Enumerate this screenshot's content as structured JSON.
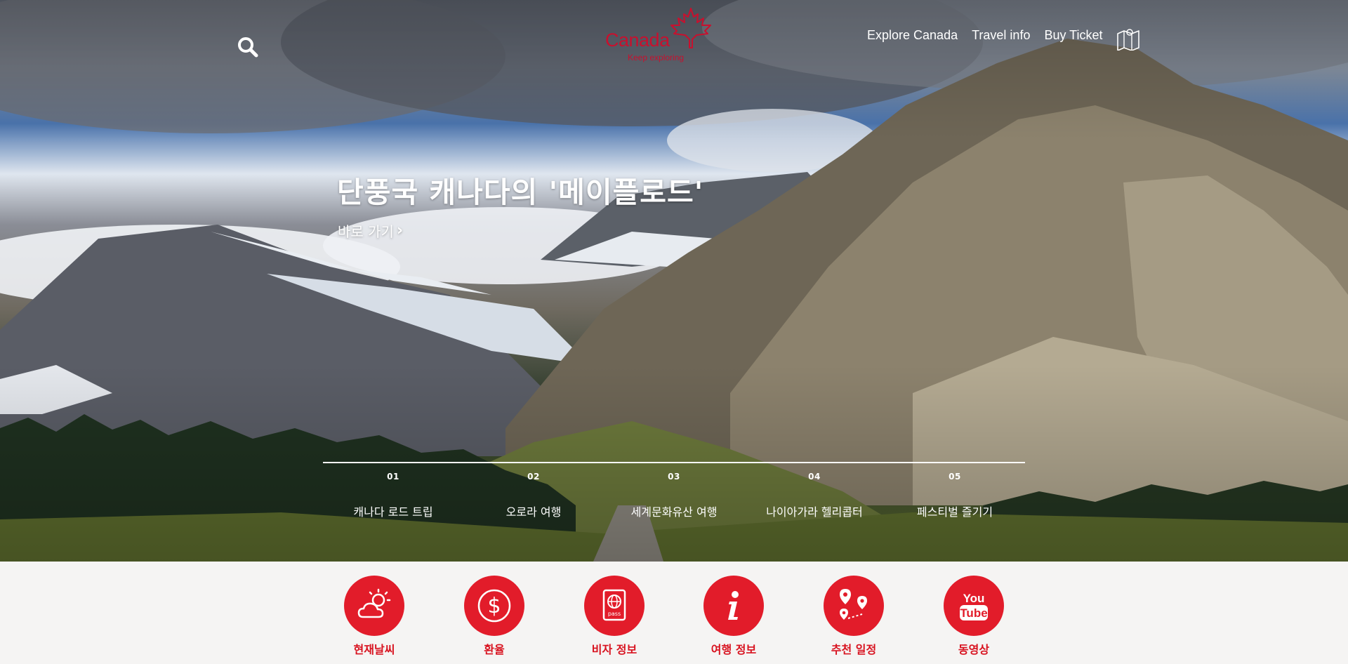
{
  "header": {
    "search_icon": "search-icon",
    "logo": {
      "brand": "Canada",
      "tagline": "Keep exploring"
    },
    "nav": [
      "Explore Canada",
      "Travel info",
      "Buy Ticket"
    ],
    "map_icon": "map-icon"
  },
  "hero": {
    "headline": "단풍국 캐나다의 '메이플로드'",
    "link": "바로 가기",
    "slides": [
      {
        "num": "01",
        "label": "캐나다 로드 트립"
      },
      {
        "num": "02",
        "label": "오로라 여행"
      },
      {
        "num": "03",
        "label": "세계문화유산 여행"
      },
      {
        "num": "04",
        "label": "나이아가라 헬리콥터"
      },
      {
        "num": "05",
        "label": "페스티벌 즐기기"
      }
    ]
  },
  "quick_menu": [
    {
      "label": "현재날씨",
      "icon": "weather-icon"
    },
    {
      "label": "환율",
      "icon": "dollar-icon"
    },
    {
      "label": "비자 정보",
      "icon": "passport-icon"
    },
    {
      "label": "여행 정보",
      "icon": "info-icon"
    },
    {
      "label": "추천 일정",
      "icon": "route-icon"
    },
    {
      "label": "동영상",
      "icon": "youtube-icon"
    }
  ],
  "colors": {
    "accent": "#e21c2a",
    "brand": "#c8102e",
    "footer_bg": "#f5f4f3"
  }
}
